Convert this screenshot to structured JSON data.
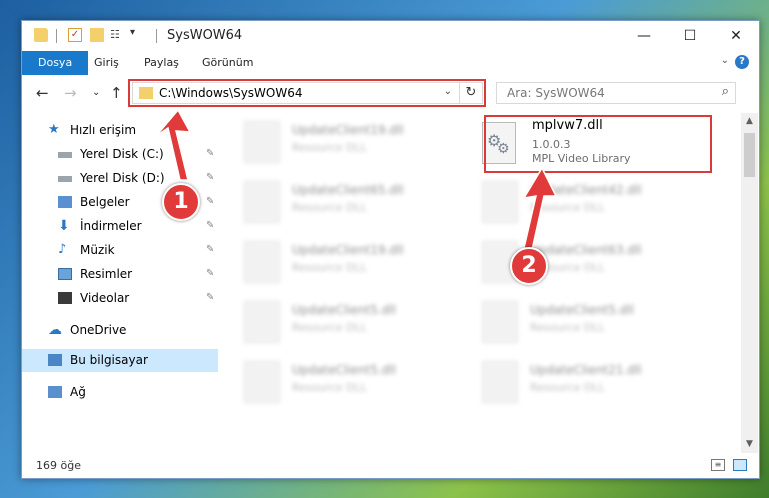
{
  "window": {
    "title": "SysWOW64",
    "minimize_glyph": "—",
    "maximize_glyph": "☐",
    "close_glyph": "✕"
  },
  "ribbon": {
    "tabs": [
      "Dosya",
      "Giriş",
      "Paylaş",
      "Görünüm"
    ]
  },
  "address": {
    "path": "C:\\Windows\\SysWOW64"
  },
  "search": {
    "placeholder": "Ara: SysWOW64"
  },
  "sidebar": {
    "items": [
      {
        "label": "Hızlı erişim",
        "icon": "star-icon"
      },
      {
        "label": "Yerel Disk (C:)",
        "icon": "drive-icon",
        "pinned": true
      },
      {
        "label": "Yerel Disk (D:)",
        "icon": "drive-icon",
        "pinned": true
      },
      {
        "label": "Belgeler",
        "icon": "documents-icon",
        "pinned": true
      },
      {
        "label": "İndirmeler",
        "icon": "downloads-icon",
        "pinned": true
      },
      {
        "label": "Müzik",
        "icon": "music-icon",
        "pinned": true
      },
      {
        "label": "Resimler",
        "icon": "pictures-icon",
        "pinned": true
      },
      {
        "label": "Videolar",
        "icon": "videos-icon",
        "pinned": true
      },
      {
        "label": "OneDrive",
        "icon": "onedrive-icon"
      },
      {
        "label": "Bu bilgisayar",
        "icon": "computer-icon",
        "selected": true
      },
      {
        "label": "Ağ",
        "icon": "network-icon"
      }
    ]
  },
  "files": {
    "left": [
      {
        "name": "UpdateClient19.dll",
        "desc": "Resource DLL"
      },
      {
        "name": "UpdateClient65.dll",
        "desc": "Resource DLL"
      },
      {
        "name": "UpdateClient19.dll",
        "desc": "Resource DLL"
      },
      {
        "name": "UpdateClient5.dll",
        "desc": "Resource DLL"
      },
      {
        "name": "UpdateClient5.dll",
        "desc": "Resource DLL"
      }
    ],
    "right": [
      {
        "name": "UpdateClient42.dll",
        "desc": "Resource DLL"
      },
      {
        "name": "UpdateClient63.dll",
        "desc": "Resource DLL"
      },
      {
        "name": "UpdateClient5.dll",
        "desc": "Resource DLL"
      },
      {
        "name": "UpdateClient21.dll",
        "desc": "Resource DLL"
      }
    ],
    "target": {
      "name": "mplvw7.dll",
      "version": "1.0.0.3",
      "desc": "MPL Video Library"
    }
  },
  "status": {
    "count": "169 öğe"
  },
  "callouts": {
    "one": "1",
    "two": "2"
  },
  "colors": {
    "accent": "#1979ca",
    "highlight": "#d93a3a",
    "selected_bg": "#cce8ff"
  }
}
